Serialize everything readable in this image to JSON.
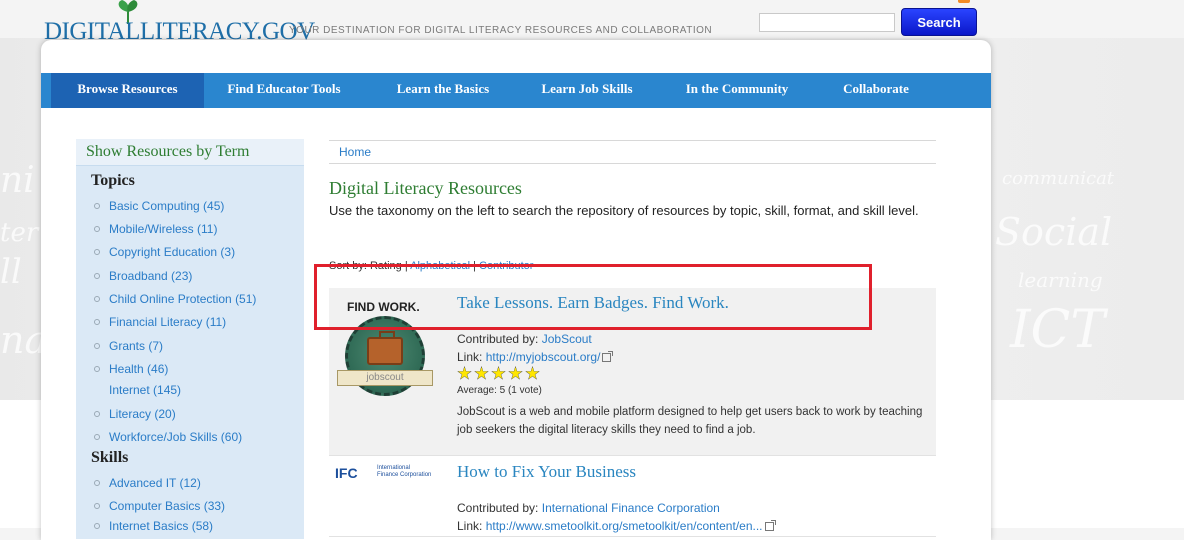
{
  "site": {
    "logo_text": "DIGITALLITERACY.GOV",
    "tagline": "YOUR DESTINATION FOR DIGITAL LITERACY RESOURCES AND COLLABORATION",
    "search_placeholder": "",
    "search_button": "Search"
  },
  "nav": [
    {
      "label": "Browse Resources",
      "active": true
    },
    {
      "label": "Find Educator Tools"
    },
    {
      "label": "Learn the Basics"
    },
    {
      "label": "Learn Job Skills"
    },
    {
      "label": "In the Community"
    },
    {
      "label": "Collaborate"
    }
  ],
  "sidebar": {
    "header": "Show Resources by Term",
    "topics_heading": "Topics",
    "topics": [
      {
        "label": "Basic Computing (45)",
        "bullet": true
      },
      {
        "label": "Mobile/Wireless (11)",
        "bullet": true
      },
      {
        "label": "Copyright Education (3)",
        "bullet": true
      },
      {
        "label": "Broadband (23)",
        "bullet": true
      },
      {
        "label": "Child Online Protection (51)",
        "bullet": true
      },
      {
        "label": "Financial Literacy (11)",
        "bullet": true
      },
      {
        "label": "Grants (7)",
        "bullet": true
      },
      {
        "label": "Health (46)",
        "bullet": true
      },
      {
        "label": "Internet (145)",
        "bullet": false
      },
      {
        "label": "Literacy (20)",
        "bullet": true
      },
      {
        "label": "Workforce/Job Skills (60)",
        "bullet": true
      }
    ],
    "skills_heading": "Skills",
    "skills": [
      {
        "label": "Advanced IT (12)",
        "bullet": true
      },
      {
        "label": "Computer Basics (33)",
        "bullet": true
      },
      {
        "label": "Internet Basics (58)",
        "bullet": true
      }
    ]
  },
  "breadcrumb": {
    "home": "Home"
  },
  "main": {
    "title": "Digital Literacy Resources",
    "intro": "Use the taxonomy on the left to search the repository of resources by topic, skill, format, and skill level.",
    "sort": {
      "prefix": "Sort by: Rating |",
      "alphabetical": "Alphabetical",
      "sep": "|",
      "contributor": "Contributor"
    }
  },
  "results": [
    {
      "title": "Take Lessons. Earn Badges. Find Work.",
      "contributed_label": "Contributed by:",
      "contributor": "JobScout",
      "link_label": "Link:",
      "link": "http://myjobscout.org/",
      "rating": 5,
      "average": "Average: 5 (1 vote)",
      "description": "JobScout is a web and mobile platform designed to help get users back to work by teaching job seekers the digital literacy skills they need to find a job.",
      "thumb_heading": "FIND WORK.",
      "thumb_banner": "jobscout"
    },
    {
      "title": "How to Fix Your Business",
      "contributed_label": "Contributed by:",
      "contributor": "International Finance Corporation",
      "link_label": "Link:",
      "link": "http://www.smetoolkit.org/smetoolkit/en/content/en...",
      "thumb_mark": "IFC",
      "thumb_sub1": "International",
      "thumb_sub2": "Finance Corporation"
    }
  ],
  "colors": {
    "nav": "#2a86cf",
    "nav_active": "#1d63b3",
    "green_heading": "#2e7d32",
    "link": "#2a7cc7",
    "highlight": "#e0202c"
  }
}
